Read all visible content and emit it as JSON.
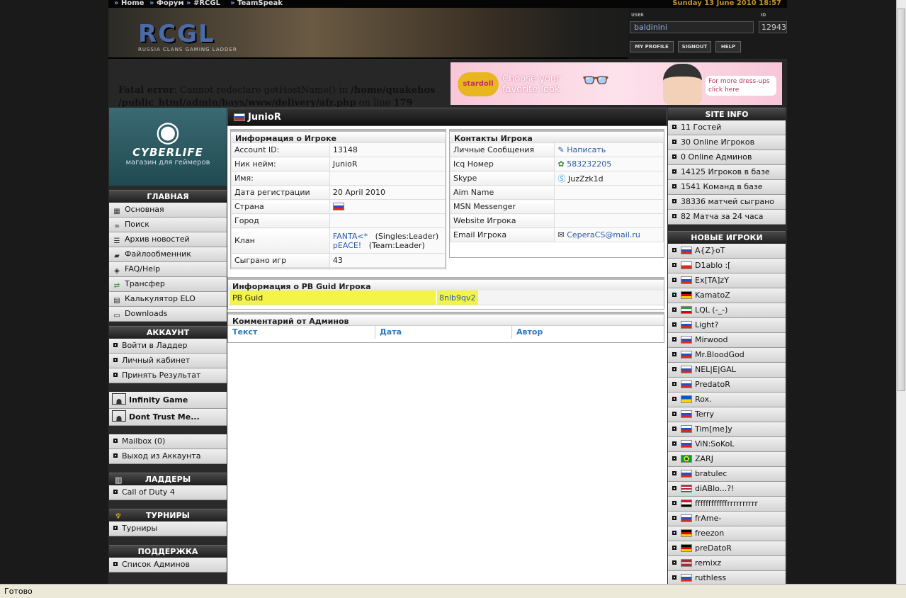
{
  "topnav": {
    "items": [
      "Home",
      "Форум",
      "#RCGL",
      "TeamSpeak"
    ],
    "date": "Sunday 13 June 2010 18:57"
  },
  "header": {
    "logo": "RCGL",
    "logo_sub": "RUSSIA CLANS GAMING LADDER",
    "user_label": "USER",
    "id_label": "ID",
    "username": "baldinini",
    "user_id": "12943",
    "buttons": [
      "MY PROFILE",
      "SIGNOUT",
      "HELP"
    ]
  },
  "error": {
    "prefix": "Fatal error",
    "text": ": Cannot redeclare getHostName() in ",
    "path": "/home/quakehos /public_html/admin/bays/www/delivery/afr.php",
    "suffix": " on line ",
    "line": "179"
  },
  "banner": {
    "logo": "stardoll",
    "tagline": "Choose your favorite look",
    "cta": "For more dress-ups click here"
  },
  "left": {
    "shop_name": "CYBERLIFE",
    "shop_sub": "магазин для геймеров",
    "main_title": "ГЛАВНАЯ",
    "main": [
      "Основная",
      "Поиск",
      "Архив новостей",
      "Файлообменник",
      "FAQ/Help",
      "Трансфер",
      "Калькулятор ELO",
      "Downloads"
    ],
    "account_title": "АККАУНТ",
    "account": [
      "Войти в Ладдер",
      "Личный кабинет",
      "Принять Результат"
    ],
    "teams": [
      "Infinity Game",
      "Dont Trust Me..."
    ],
    "misc": [
      "Mailbox (0)",
      "Выход из Аккаунта"
    ],
    "ladders_title": "ЛАДДЕРЫ",
    "ladders": [
      "Call of Duty 4"
    ],
    "tour_title": "ТУРНИРЫ",
    "tours": [
      "Турниры"
    ],
    "support_title": "ПОДДЕРЖКА",
    "support": [
      "Список Админов"
    ]
  },
  "profile": {
    "name": "JunioR",
    "info_title": "Информация о Игроке",
    "info": [
      {
        "k": "Account ID:",
        "v": "13148"
      },
      {
        "k": "Ник нейм:",
        "v": "JunioR"
      },
      {
        "k": "Имя:",
        "v": ""
      },
      {
        "k": "Дата регистрации",
        "v": "20 April 2010"
      },
      {
        "k": "Страна",
        "v": ""
      },
      {
        "k": "Город",
        "v": ""
      }
    ],
    "clan_label": "Клан",
    "clan1": "FANTA<*",
    "clan1_role": "(Singles:Leader)",
    "clan2": "pEACE!",
    "clan2_role": "(Team:Leader)",
    "games_label": "Сыграно игр",
    "games": "43",
    "contacts_title": "Контакты Игрока",
    "contacts": [
      {
        "k": "Личные Сообщения",
        "v": "Написать"
      },
      {
        "k": "Icq Номер",
        "v": "583232205"
      },
      {
        "k": "Skype",
        "v": "JuzZzk1d"
      },
      {
        "k": "Aim Name",
        "v": ""
      },
      {
        "k": "MSN Messenger",
        "v": ""
      },
      {
        "k": "Website Игрока",
        "v": ""
      },
      {
        "k": "Email Игрока",
        "v": "CeperaCS@mail.ru"
      }
    ],
    "pb_title": "Информация о PB Guid Игрока",
    "pb_label": "PB Guid",
    "pb_value": "8nlb9qv2",
    "comments_title": "Комментарий от Админов",
    "comment_cols": [
      "Текст",
      "Дата",
      "Автор"
    ]
  },
  "right": {
    "site_title": "SITE INFO",
    "site": [
      "11 Гостей",
      "30 Online Игроков",
      "0 Online Админов",
      "14125 Игроков в базе",
      "1541 Команд в базе",
      "38336 матчей сыграно",
      "82 Матча за 24 часа"
    ],
    "new_title": "НОВЫЕ ИГРОКИ",
    "players": [
      "A{Z}oT",
      "D1ablo :[",
      "Ex[TA]zY",
      "KamatoZ",
      "LQL (-_-)",
      "Light?",
      "Mirwood",
      "Mr.BloodGod",
      "NEL|E|GAL",
      "PredatoR",
      "Rox.",
      "Terry",
      "Tim[me]y",
      "ViN:SoKoL",
      "ZARJ",
      "bratulec",
      "diABlo...?!",
      "ffffffffffffrrrrrrrrrr",
      "frAme-",
      "freezon",
      "preDatoR",
      "remixz",
      "ruthless"
    ]
  },
  "status": "Готово",
  "colors": {
    "link": "#2a5ca8",
    "highlight": "#f3f34a",
    "header_dark": "#1e1e1e"
  }
}
